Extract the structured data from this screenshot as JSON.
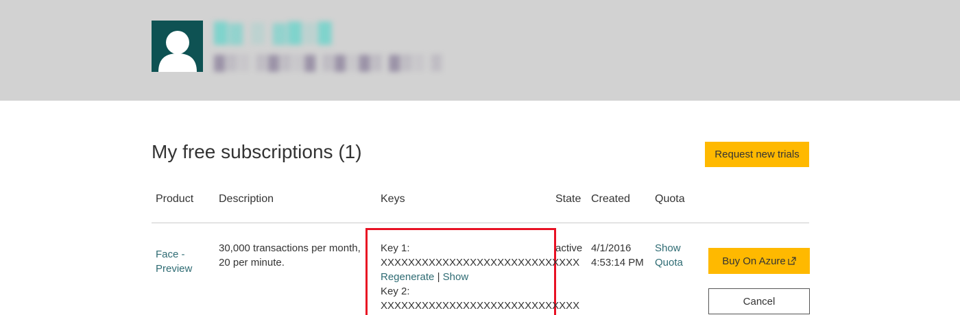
{
  "header": {
    "avatar_icon": "user-avatar-icon",
    "user_name": "█▓ ▒ ▓█▒█",
    "user_email": "▓▒░ ▒▓▒░▓ ▒▓░▓▒ ▓▒░ ▒"
  },
  "page": {
    "title": "My free subscriptions (1)",
    "request_button": "Request new trials"
  },
  "table": {
    "headers": {
      "product": "Product",
      "description": "Description",
      "keys": "Keys",
      "state": "State",
      "created": "Created",
      "quota": "Quota"
    },
    "rows": [
      {
        "product_line1": "Face -",
        "product_line2": "Preview",
        "description_line1": "30,000 transactions per month,",
        "description_line2": "20 per minute.",
        "key1_label": "Key 1:",
        "key1_value": "XXXXXXXXXXXXXXXXXXXXXXXXXXXXX",
        "regenerate": "Regenerate",
        "separator": "|",
        "show": "Show",
        "key2_label": "Key 2:",
        "key2_value": "XXXXXXXXXXXXXXXXXXXXXXXXXXXXX",
        "state": "active",
        "created_date": "4/1/2016",
        "created_time": "4:53:14 PM",
        "quota_line1": "Show",
        "quota_line2": "Quota",
        "buy_button": "Buy On Azure",
        "cancel_button": "Cancel"
      }
    ]
  },
  "colors": {
    "header_bg": "#d2d2d2",
    "avatar_bg": "#0e5253",
    "accent_button": "#ffb900",
    "link": "#2e6b73",
    "highlight_box": "#e81123"
  }
}
